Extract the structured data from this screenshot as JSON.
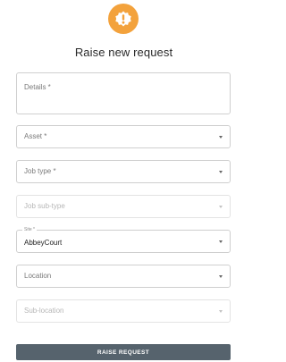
{
  "header": {
    "logo_icon": "exclamation-badge-icon",
    "logo_color": "#f3a23c",
    "title": "Raise new request"
  },
  "form": {
    "details": {
      "placeholder": "Details *"
    },
    "asset": {
      "placeholder": "Asset *",
      "icon": "chevron-down-icon"
    },
    "job_type": {
      "placeholder": "Job type *",
      "icon": "chevron-down-icon"
    },
    "job_subtype": {
      "placeholder": "Job sub-type",
      "disabled": true,
      "icon": "chevron-down-icon"
    },
    "site": {
      "label": "Site *",
      "value": "AbbeyCourt",
      "icon": "chevron-down-icon"
    },
    "location": {
      "placeholder": "Location",
      "icon": "chevron-down-icon"
    },
    "sub_location": {
      "placeholder": "Sub-location",
      "disabled": true,
      "icon": "chevron-down-icon"
    }
  },
  "actions": {
    "submit_label": "RAISE REQUEST",
    "submit_color": "#56636d"
  }
}
